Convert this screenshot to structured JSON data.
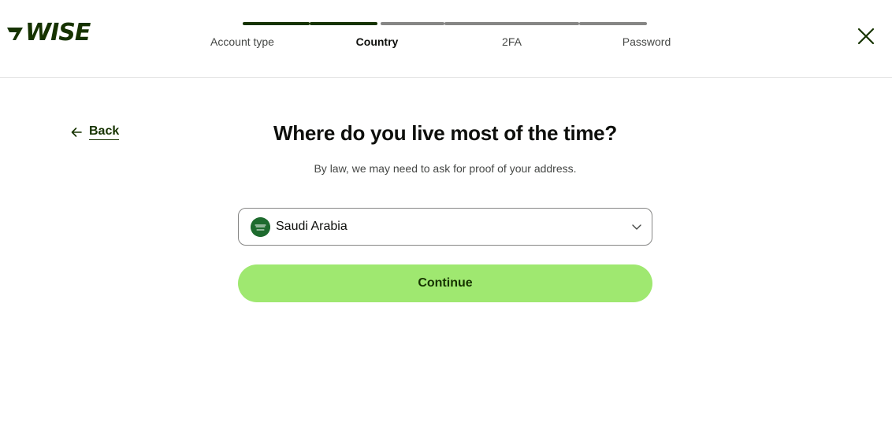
{
  "brand": {
    "logo_text": "WISE",
    "color": "#163300",
    "accent": "#9fe870"
  },
  "steps": [
    {
      "label": "Account type",
      "state": "complete"
    },
    {
      "label": "Country",
      "state": "active"
    },
    {
      "label": "2FA",
      "state": "upcoming"
    },
    {
      "label": "Password",
      "state": "upcoming"
    }
  ],
  "step_colors": {
    "complete": "#163300",
    "upcoming": "#868685"
  },
  "header": {
    "close_icon": "close-icon"
  },
  "nav": {
    "back_label": "Back",
    "back_icon": "arrow-left-icon"
  },
  "main": {
    "title": "Where do you live most of the time?",
    "subtitle": "By law, we may need to ask for proof of your address.",
    "country_select": {
      "value": "Saudi Arabia",
      "flag_icon": "saudi-arabia-flag-icon",
      "chevron_icon": "chevron-down-icon"
    },
    "continue_label": "Continue"
  }
}
